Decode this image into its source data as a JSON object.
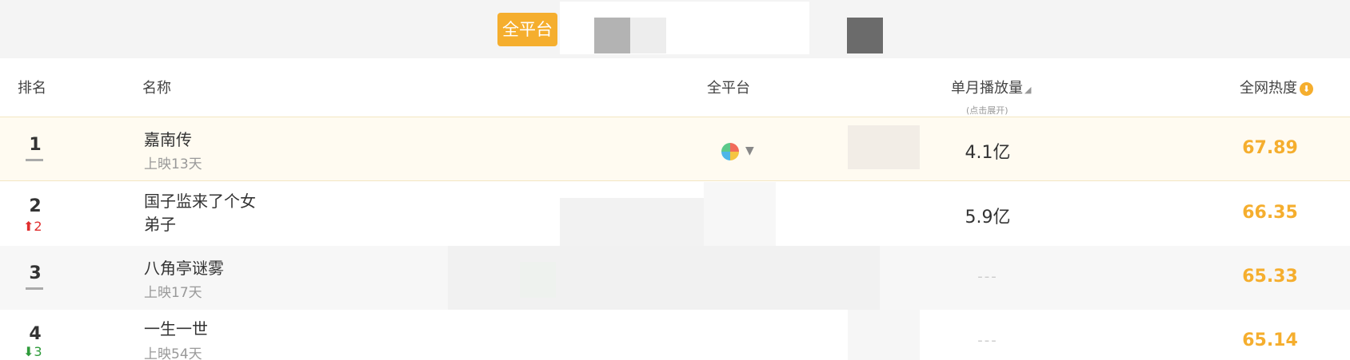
{
  "topbar": {
    "platform_tab": "全平台"
  },
  "header": {
    "rank": "排名",
    "name": "名称",
    "platform": "全平台",
    "play": "单月播放量",
    "play_sort_glyph": "◢",
    "play_sub": "(点击展开)",
    "heat": "全网热度",
    "heat_icon_glyph": "⬇"
  },
  "rows": [
    {
      "rank": "1",
      "title": "嘉南传",
      "sub": "上映13天",
      "play": "4.1亿",
      "heat": "67.89"
    },
    {
      "rank": "2",
      "change": "2",
      "change_dir": "up",
      "change_glyph": "⬆",
      "title_line1": "国子监来了个女",
      "title_line2": "弟子",
      "play": "5.9亿",
      "heat": "66.35"
    },
    {
      "rank": "3",
      "title": "八角亭谜雾",
      "sub": "上映17天",
      "play": "---",
      "heat": "65.33"
    },
    {
      "rank": "4",
      "change": "3",
      "change_dir": "down",
      "change_glyph": "⬇",
      "title": "一生一世",
      "sub": "上映54天",
      "play": "---",
      "heat": "65.14"
    }
  ],
  "colors": {
    "accent": "#f5ae2e",
    "up": "#e02e2e",
    "down": "#2e9b3a"
  },
  "icons": {
    "platform_pie": "multi-platform-pie-icon",
    "dropdown": "caret-down-icon"
  }
}
